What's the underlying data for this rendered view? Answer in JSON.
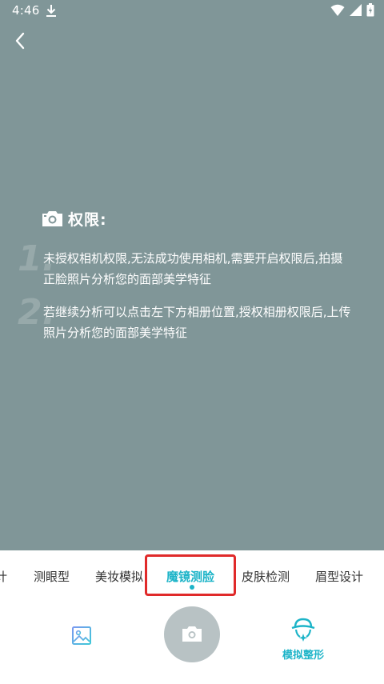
{
  "status_bar": {
    "time": "4:46"
  },
  "permission": {
    "title": "权限:",
    "items": [
      {
        "num": "1.",
        "text": "未授权相机权限,无法成功使用相机,需要开启权限后,拍摄正脸照片分析您的面部美学特征"
      },
      {
        "num": "2.",
        "text": "若继续分析可以点击左下方相册位置,授权相册权限后,上传照片分析您的面部美学特征"
      }
    ]
  },
  "mode_tabs": {
    "partial_left": "计",
    "items": [
      "测眼型",
      "美妆模拟",
      "魔镜测脸",
      "皮肤检测",
      "眉型设计"
    ],
    "active": "魔镜测脸"
  },
  "bottom": {
    "simulate_label": "模拟整形"
  },
  "colors": {
    "accent": "#1db4c8",
    "camera_bg": "#809698",
    "highlight": "#e02a2a"
  },
  "icons": [
    "download-icon",
    "wifi-icon",
    "signal-icon",
    "battery-icon",
    "back-chevron-icon",
    "camera-icon",
    "gallery-icon",
    "face-sparkle-icon"
  ]
}
